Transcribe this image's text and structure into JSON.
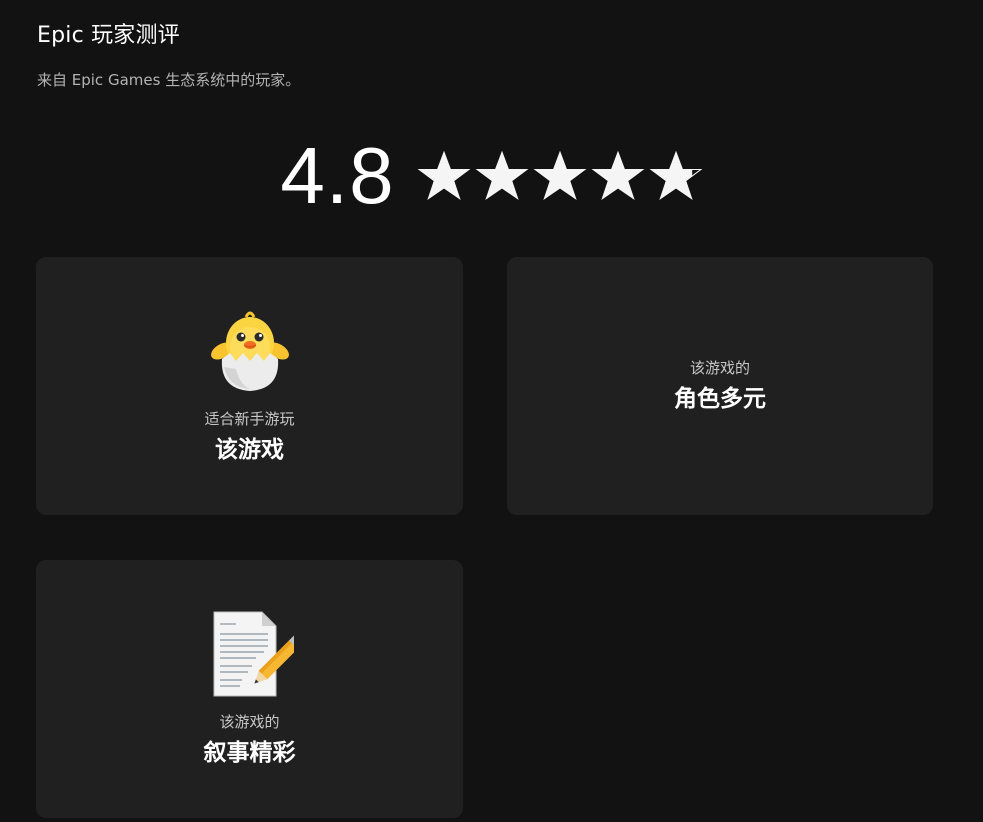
{
  "header": {
    "title": "Epic 玩家测评",
    "subtitle": "来自 Epic Games 生态系统中的玩家。"
  },
  "rating": {
    "score": "4.8",
    "stars_value": 4.8,
    "stars_max": 5,
    "star_icon": "star-icon",
    "star_color": "#f5f5f5"
  },
  "cards": [
    {
      "icon": "hatching-chick-icon",
      "label": "适合新手游玩",
      "value": "该游戏"
    },
    {
      "label": "该游戏的",
      "value": "角色多元"
    },
    {
      "icon": "memo-pencil-icon",
      "label": "该游戏的",
      "value": "叙事精彩"
    }
  ],
  "colors": {
    "background": "#121212",
    "card": "#202020",
    "text": "#ffffff",
    "muted": "#b3b3b3"
  }
}
